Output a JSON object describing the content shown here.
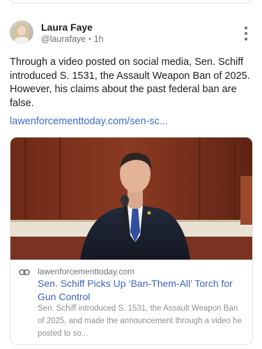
{
  "post": {
    "author_name": "Laura Faye",
    "author_handle": "@laurafaye",
    "time_ago": "1h",
    "text": "Through a video posted on social media, Sen. Schiff introduced S. 1531, the Assault Weapon Ban of 2025. However, his claims about the past federal ban are false.",
    "link_text": "lawenforcementtoday.com/sen-sc..."
  },
  "link_card": {
    "domain": "lawenforcementtoday.com",
    "title": "Sen. Schiff Picks Up ‘Ban-Them-All’ Torch for Gun Control",
    "description": "Sen. Schiff introduced S. 1531, the Assault Weapon Ban of 2025, and made the announcement through a video he posted to so..."
  },
  "icons": {
    "more": "more-vertical-icon",
    "link": "link-icon"
  },
  "colors": {
    "link": "#3f6ac8",
    "card_title": "#3a63bf",
    "muted": "#6e6e73"
  }
}
